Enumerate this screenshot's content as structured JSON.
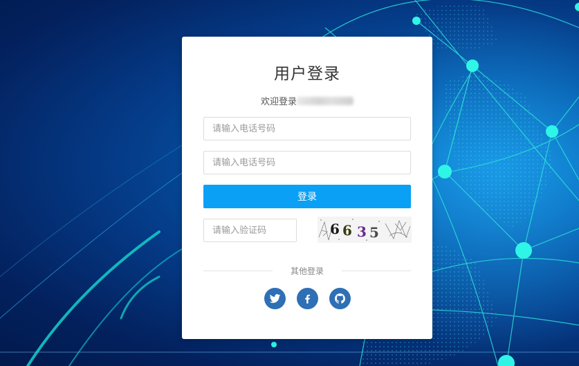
{
  "login": {
    "title": "用户登录",
    "welcome_text": "欢迎登录",
    "phone_placeholder_1": "请输入电话号码",
    "phone_placeholder_2": "请输入电话号码",
    "login_button": "登录",
    "captcha_placeholder": "请输入验证码",
    "captcha_text": "6635",
    "other_login_label": "其他登录"
  },
  "socials": [
    {
      "name": "twitter",
      "icon": "twitter-icon"
    },
    {
      "name": "facebook",
      "icon": "facebook-icon"
    },
    {
      "name": "github",
      "icon": "github-icon"
    }
  ],
  "colors": {
    "primary_button": "#0aa0f5",
    "social_icon_bg": "#2e6fb5",
    "background_dark": "#021a4d",
    "background_glow": "#0a7fd0",
    "network_lines": "#2de0d8"
  }
}
